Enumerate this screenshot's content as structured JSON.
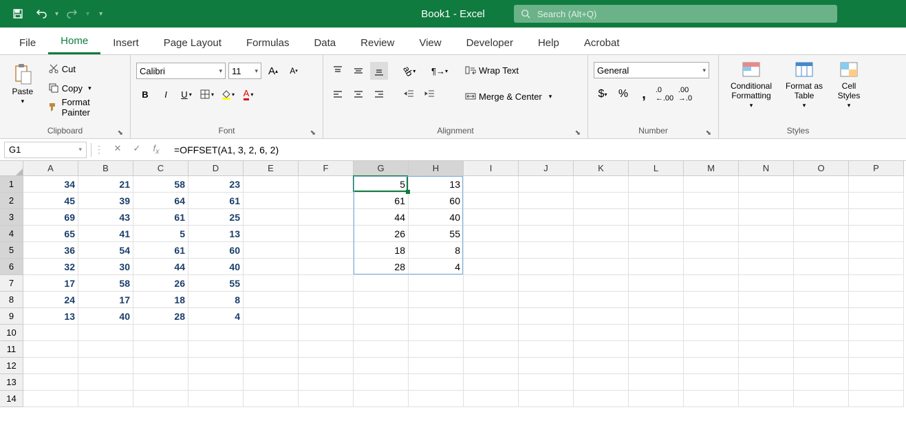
{
  "title": "Book1 - Excel",
  "search_placeholder": "Search (Alt+Q)",
  "tabs": [
    "File",
    "Home",
    "Insert",
    "Page Layout",
    "Formulas",
    "Data",
    "Review",
    "View",
    "Developer",
    "Help",
    "Acrobat"
  ],
  "active_tab": "Home",
  "clipboard": {
    "paste": "Paste",
    "cut": "Cut",
    "copy": "Copy",
    "format_painter": "Format Painter",
    "label": "Clipboard"
  },
  "font": {
    "name": "Calibri",
    "size": "11",
    "label": "Font"
  },
  "alignment": {
    "wrap": "Wrap Text",
    "merge": "Merge & Center",
    "label": "Alignment"
  },
  "number": {
    "format": "General",
    "label": "Number"
  },
  "styles": {
    "cond": "Conditional Formatting",
    "table": "Format as Table",
    "cell": "Cell Styles",
    "label": "Styles"
  },
  "name_box": "G1",
  "formula": "=OFFSET(A1, 3, 2, 6, 2)",
  "columns": [
    "A",
    "B",
    "C",
    "D",
    "E",
    "F",
    "G",
    "H",
    "I",
    "J",
    "K",
    "L",
    "M",
    "N",
    "O",
    "P"
  ],
  "row_count": 14,
  "source_data": [
    [
      34,
      21,
      58,
      23
    ],
    [
      45,
      39,
      64,
      61
    ],
    [
      69,
      43,
      61,
      25
    ],
    [
      65,
      41,
      5,
      13
    ],
    [
      36,
      54,
      61,
      60
    ],
    [
      32,
      30,
      44,
      40
    ],
    [
      17,
      58,
      26,
      55
    ],
    [
      24,
      17,
      18,
      8
    ],
    [
      13,
      40,
      28,
      4
    ]
  ],
  "spill_data": [
    [
      5,
      13
    ],
    [
      61,
      60
    ],
    [
      44,
      40
    ],
    [
      26,
      55
    ],
    [
      18,
      8
    ],
    [
      28,
      4
    ]
  ],
  "active_cell": {
    "col": 6,
    "row": 0
  },
  "spill_range": {
    "col": 6,
    "row": 0,
    "w": 2,
    "h": 6
  }
}
